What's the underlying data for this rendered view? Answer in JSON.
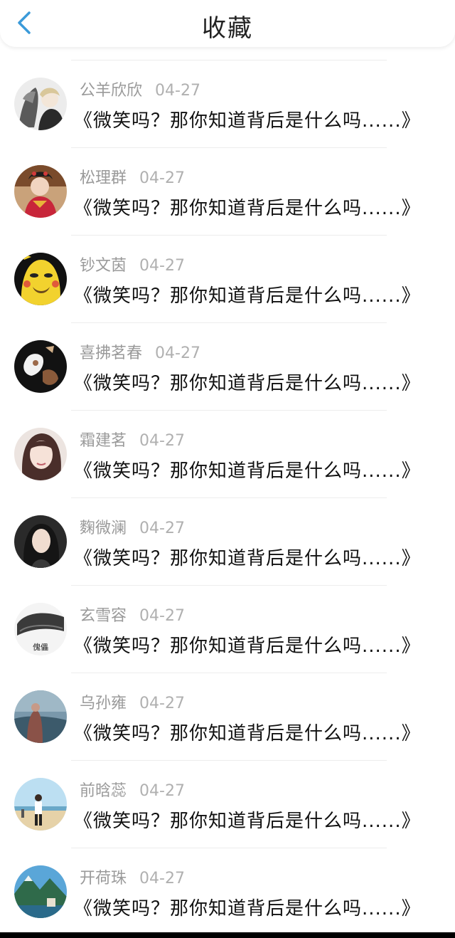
{
  "header": {
    "title": "收藏"
  },
  "list": [
    {
      "name": "公羊欣欣",
      "date": "04-27",
      "message": "《微笑吗？那你知道背后是什么吗......》"
    },
    {
      "name": "松理群",
      "date": "04-27",
      "message": "《微笑吗？那你知道背后是什么吗......》"
    },
    {
      "name": "钞文茵",
      "date": "04-27",
      "message": "《微笑吗？那你知道背后是什么吗......》"
    },
    {
      "name": "喜拂茗春",
      "date": "04-27",
      "message": "《微笑吗？那你知道背后是什么吗......》"
    },
    {
      "name": "霜建茗",
      "date": "04-27",
      "message": "《微笑吗？那你知道背后是什么吗......》"
    },
    {
      "name": "麴微澜",
      "date": "04-27",
      "message": "《微笑吗？那你知道背后是什么吗......》"
    },
    {
      "name": "玄雪容",
      "date": "04-27",
      "message": "《微笑吗？那你知道背后是什么吗......》"
    },
    {
      "name": "乌孙雍",
      "date": "04-27",
      "message": "《微笑吗？那你知道背后是什么吗......》"
    },
    {
      "name": "前晗蕊",
      "date": "04-27",
      "message": "《微笑吗？那你知道背后是什么吗......》"
    },
    {
      "name": "开荷珠",
      "date": "04-27",
      "message": "《微笑吗？那你知道背后是什么吗......》"
    }
  ],
  "avatar7_caption": "傀儡",
  "colors": {
    "accent": "#3a9ad9",
    "name": "#9a9a9a",
    "date": "#b0b0b0",
    "text": "#111111"
  }
}
